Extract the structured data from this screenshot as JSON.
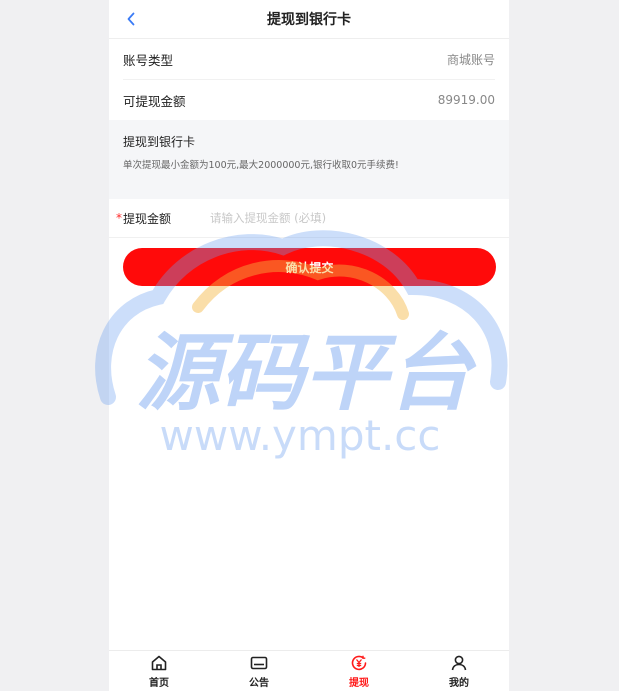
{
  "nav": {
    "title": "提现到银行卡"
  },
  "account": [
    {
      "label": "账号类型",
      "value": "商城账号"
    },
    {
      "label": "可提现金额",
      "value": "89919.00"
    }
  ],
  "notice": {
    "title": "提现到银行卡",
    "desc": "单次提现最小金额为100元,最大2000000元,银行收取0元手续费!"
  },
  "form": {
    "required_mark": "*",
    "amount_label": "提现金额",
    "amount_placeholder": "请输入提现金额 (必填)",
    "submit_label": "确认提交"
  },
  "watermark": {
    "title": "源码平台",
    "url": "www.ympt.cc"
  },
  "tabs": [
    {
      "label": "首页",
      "icon": "home-icon",
      "active": false
    },
    {
      "label": "公告",
      "icon": "announcement-icon",
      "active": false
    },
    {
      "label": "提现",
      "icon": "withdraw-icon",
      "active": true
    },
    {
      "label": "我的",
      "icon": "user-icon",
      "active": false
    }
  ],
  "colors": {
    "primary": "#ff0a0a",
    "back_arrow": "#3a7bf6",
    "active_tab": "#ff1a1a",
    "watermark_blue": "#6ea0f0",
    "watermark_orange": "#f5b540"
  }
}
